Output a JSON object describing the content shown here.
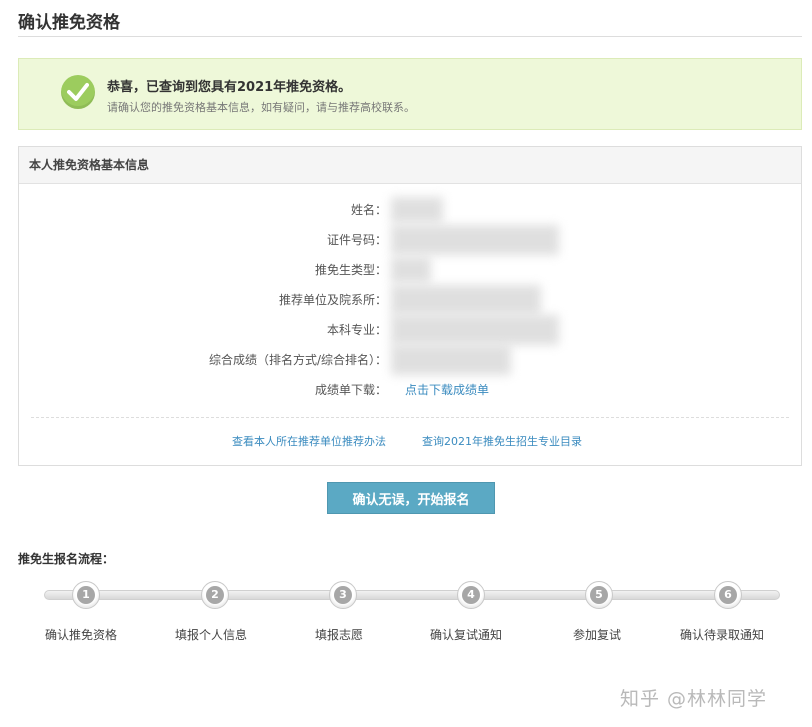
{
  "page": {
    "title": "确认推免资格"
  },
  "notice": {
    "title": "恭喜，已查询到您具有2021年推免资格。",
    "subtitle": "请确认您的推免资格基本信息，如有疑问，请与推荐高校联系。"
  },
  "info": {
    "heading": "本人推免资格基本信息",
    "fields": [
      {
        "label": "姓名：",
        "value": ""
      },
      {
        "label": "证件号码：",
        "value": ""
      },
      {
        "label": "推免生类型：",
        "value": ""
      },
      {
        "label": "推荐单位及院系所：",
        "value": ""
      },
      {
        "label": "本科专业：",
        "value": ""
      },
      {
        "label": "综合成绩（排名方式/综合排名）：",
        "value": ""
      },
      {
        "label": "成绩单下载：",
        "value": "点击下载成绩单"
      }
    ],
    "links": [
      "查看本人所在推荐单位推荐办法",
      "查询2021年推免生招生专业目录"
    ]
  },
  "confirm_button": "确认无误，开始报名",
  "flow": {
    "title": "推免生报名流程：",
    "steps": [
      {
        "num": "1",
        "label": "确认推免资格"
      },
      {
        "num": "2",
        "label": "填报个人信息"
      },
      {
        "num": "3",
        "label": "填报志愿"
      },
      {
        "num": "4",
        "label": "确认复试通知"
      },
      {
        "num": "5",
        "label": "参加复试"
      },
      {
        "num": "6",
        "label": "确认待录取通知"
      }
    ]
  },
  "watermark": "知乎 @林林同学",
  "colors": {
    "success_bg": "#eef8d9",
    "check": "#9ccc5e",
    "link": "#3a8bbf",
    "button": "#5ba9c4",
    "step": "#a7a7a7"
  }
}
